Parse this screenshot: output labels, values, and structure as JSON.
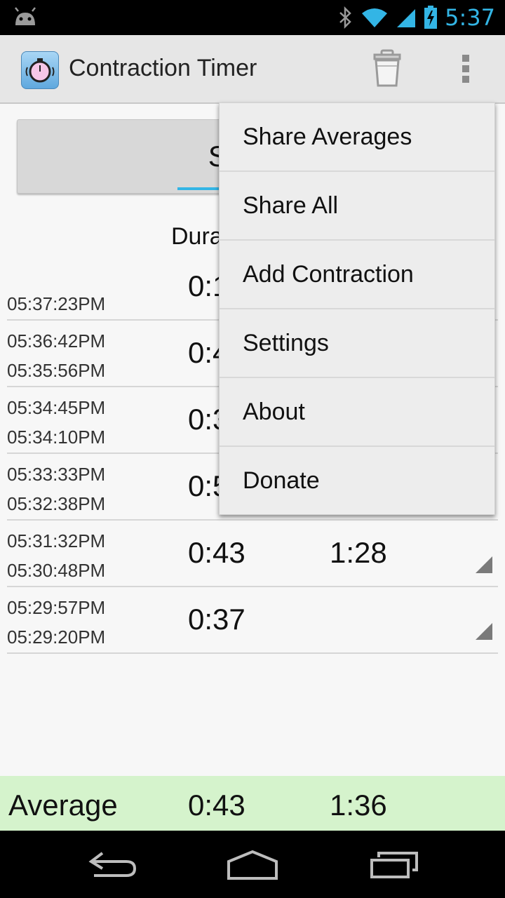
{
  "status_bar": {
    "time": "5:37",
    "icons": [
      "android-debug-icon",
      "bluetooth-icon",
      "wifi-icon",
      "cell-signal-icon",
      "battery-charging-icon"
    ]
  },
  "action_bar": {
    "title": "Contraction Timer",
    "icons": [
      "stopwatch-app-icon",
      "trash-icon",
      "overflow-menu-icon"
    ]
  },
  "main": {
    "button_label": "Stop C",
    "duration_header": "Dura",
    "rows": [
      {
        "start": "",
        "end": "05:37:23PM",
        "duration": "0:1",
        "frequency": ""
      },
      {
        "start": "05:36:42PM",
        "end": "05:35:56PM",
        "duration": "0:4",
        "frequency": ""
      },
      {
        "start": "05:34:45PM",
        "end": "05:34:10PM",
        "duration": "0:3",
        "frequency": ""
      },
      {
        "start": "05:33:33PM",
        "end": "05:32:38PM",
        "duration": "0:5",
        "frequency": ""
      },
      {
        "start": "05:31:32PM",
        "end": "05:30:48PM",
        "duration": "0:43",
        "frequency": "1:28"
      },
      {
        "start": "05:29:57PM",
        "end": "05:29:20PM",
        "duration": "0:37",
        "frequency": ""
      }
    ]
  },
  "average": {
    "label": "Average",
    "duration": "0:43",
    "frequency": "1:36"
  },
  "menu": {
    "items": [
      {
        "label": "Share Averages"
      },
      {
        "label": "Share All"
      },
      {
        "label": "Add Contraction"
      },
      {
        "label": "Settings"
      },
      {
        "label": "About"
      },
      {
        "label": "Donate"
      }
    ]
  },
  "nav_bar": {
    "icons": [
      "back-icon",
      "home-icon",
      "recent-apps-icon"
    ]
  },
  "colors": {
    "accent": "#33b5e5",
    "average_bar": "#d5f3cc",
    "action_bar": "#e6e6e6"
  }
}
